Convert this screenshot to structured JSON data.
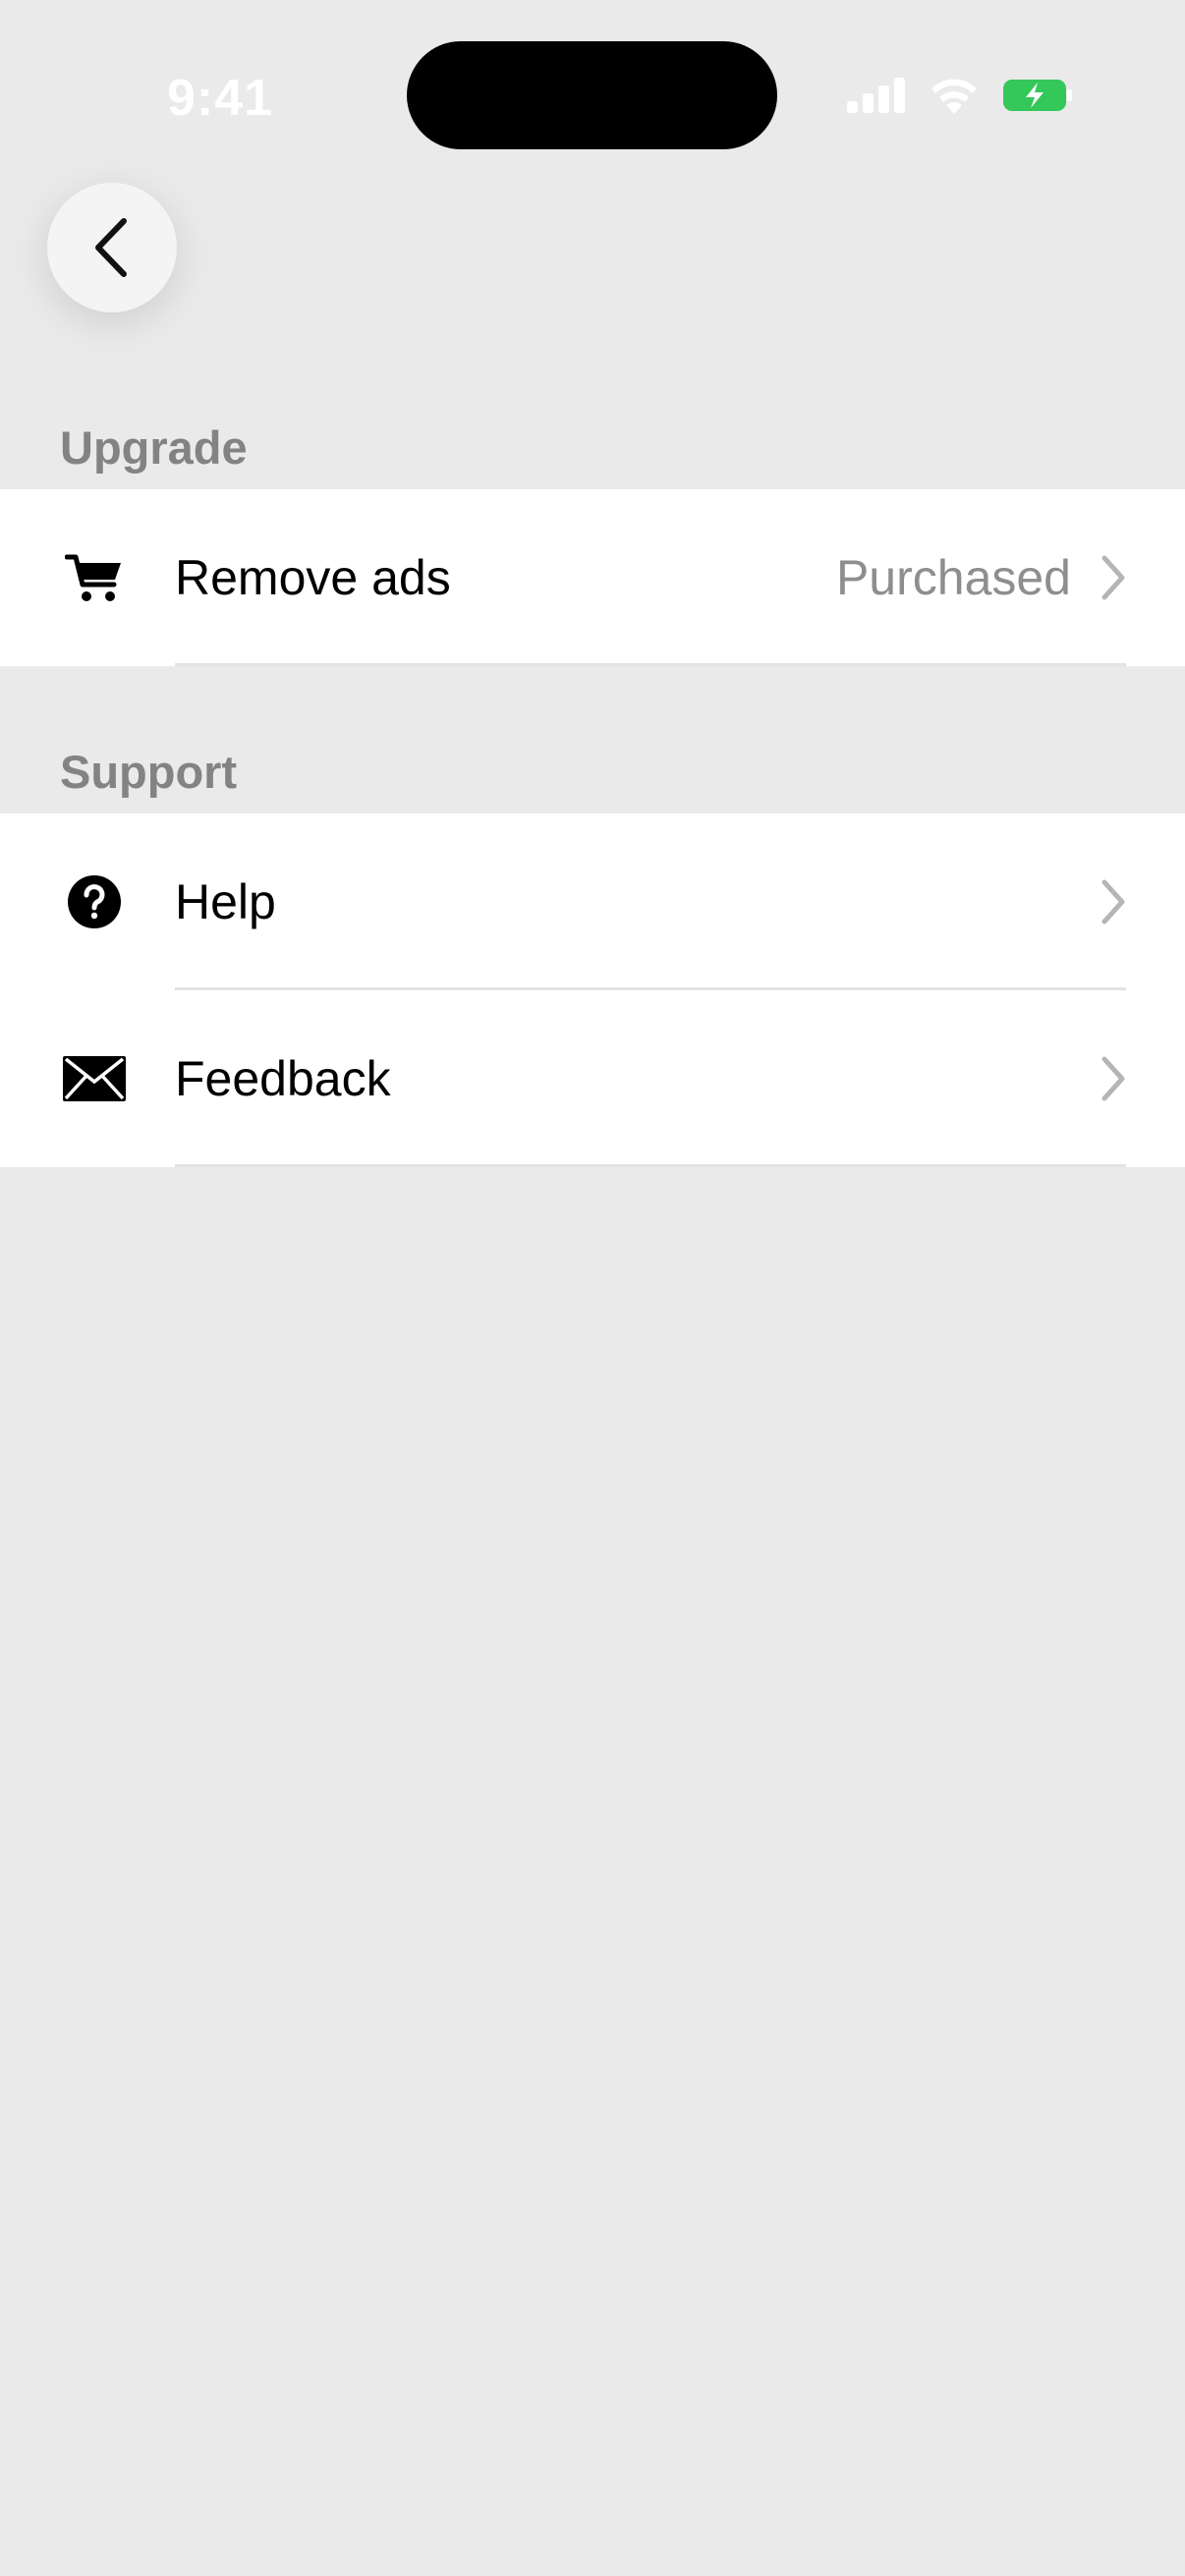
{
  "status_bar": {
    "time": "9:41",
    "icons": [
      "cellular-signal-icon",
      "wifi-icon",
      "battery-charging-icon"
    ],
    "battery_color": "#34C759"
  },
  "nav": {
    "back_icon": "chevron-left-icon"
  },
  "sections": {
    "upgrade": {
      "title": "Upgrade",
      "items": [
        {
          "label": "Remove ads",
          "value": "Purchased",
          "icon": "cart-icon"
        }
      ]
    },
    "support": {
      "title": "Support",
      "items": [
        {
          "label": "Help",
          "icon": "help-circle-icon"
        },
        {
          "label": "Feedback",
          "icon": "envelope-icon"
        }
      ]
    }
  },
  "colors": {
    "background": "#EAEAEA",
    "row_background": "#FFFFFF",
    "section_header": "#838383",
    "secondary_text": "#8E8E8E",
    "chevron": "#B5B5B5"
  }
}
